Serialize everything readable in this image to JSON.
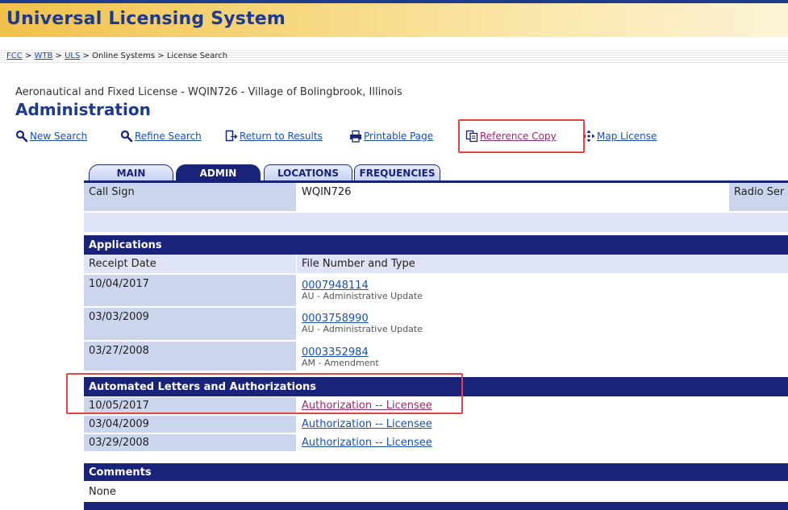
{
  "banner": {
    "title": "Universal Licensing System"
  },
  "breadcrumb": {
    "items": [
      "FCC",
      "WTB",
      "ULS",
      "Online Systems"
    ],
    "current": "License Search",
    "separator": ">"
  },
  "license": {
    "subtitle": "Aeronautical and Fixed License - WQIN726 - Village of Bolingbrook, Illinois"
  },
  "page_title": "Administration",
  "actions": {
    "new_search": "New Search",
    "refine_search": "Refine Search",
    "return_results": "Return to Results",
    "printable_page": "Printable Page",
    "reference_copy": "Reference Copy",
    "map_license": "Map License"
  },
  "tabs": [
    "MAIN",
    "ADMIN",
    "LOCATIONS",
    "FREQUENCIES"
  ],
  "active_tab": "ADMIN",
  "call_sign": {
    "label": "Call Sign",
    "value": "WQIN726",
    "radio_label": "Radio Ser"
  },
  "applications": {
    "title": "Applications",
    "headers": [
      "Receipt Date",
      "File Number and Type"
    ],
    "rows": [
      {
        "date": "10/04/2017",
        "file": "0007948114",
        "type": "AU - Administrative Update"
      },
      {
        "date": "03/03/2009",
        "file": "0003758990",
        "type": "AU - Administrative Update"
      },
      {
        "date": "03/27/2008",
        "file": "0003352984",
        "type": "AM - Amendment"
      }
    ]
  },
  "letters": {
    "title": "Automated Letters and Authorizations",
    "rows": [
      {
        "date": "10/05/2017",
        "label": "Authorization -- Licensee"
      },
      {
        "date": "03/04/2009",
        "label": "Authorization -- Licensee"
      },
      {
        "date": "03/29/2008",
        "label": "Authorization -- Licensee"
      }
    ]
  },
  "comments": {
    "title": "Comments",
    "value": "None"
  },
  "colors": {
    "navy": "#1a237a",
    "link": "#1a4fb0",
    "visited": "#9a2a6a",
    "highlight": "#e0463f",
    "banner": "#f0c14a"
  }
}
